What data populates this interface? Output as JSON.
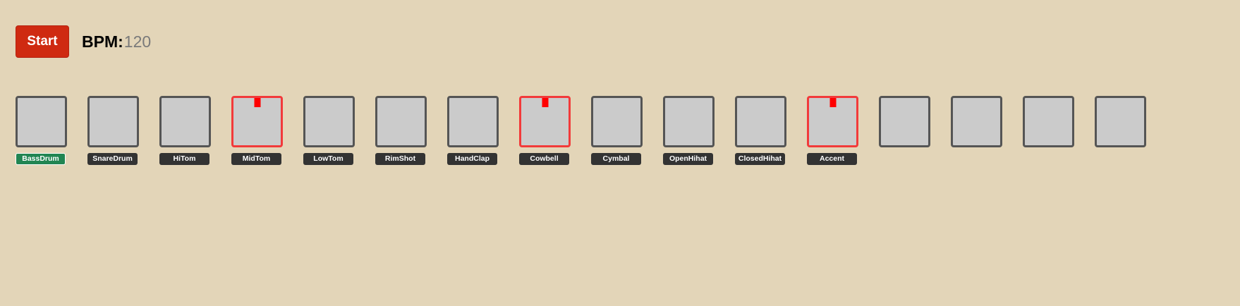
{
  "toolbar": {
    "start_label": "Start",
    "bpm_label": "BPM:",
    "bpm_value": "120"
  },
  "colors": {
    "background": "#e3d5b8",
    "start_button": "#cf2a11",
    "pad_fill": "#cbcbcb",
    "pad_border": "#555555",
    "pad_active_border": "#f23a3a",
    "marker": "#ff0000",
    "label_bg": "#333333",
    "label_selected_bg": "#218552"
  },
  "steps": [
    {
      "active": false,
      "label": "BassDrum",
      "selected": true
    },
    {
      "active": false,
      "label": "SnareDrum",
      "selected": false
    },
    {
      "active": false,
      "label": "HiTom",
      "selected": false
    },
    {
      "active": true,
      "label": "MidTom",
      "selected": false
    },
    {
      "active": false,
      "label": "LowTom",
      "selected": false
    },
    {
      "active": false,
      "label": "RimShot",
      "selected": false
    },
    {
      "active": false,
      "label": "HandClap",
      "selected": false
    },
    {
      "active": true,
      "label": "Cowbell",
      "selected": false
    },
    {
      "active": false,
      "label": "Cymbal",
      "selected": false
    },
    {
      "active": false,
      "label": "OpenHihat",
      "selected": false
    },
    {
      "active": false,
      "label": "ClosedHihat",
      "selected": false
    },
    {
      "active": true,
      "label": "Accent",
      "selected": false
    },
    {
      "active": false,
      "label": null,
      "selected": false
    },
    {
      "active": false,
      "label": null,
      "selected": false
    },
    {
      "active": false,
      "label": null,
      "selected": false
    },
    {
      "active": false,
      "label": null,
      "selected": false
    }
  ]
}
